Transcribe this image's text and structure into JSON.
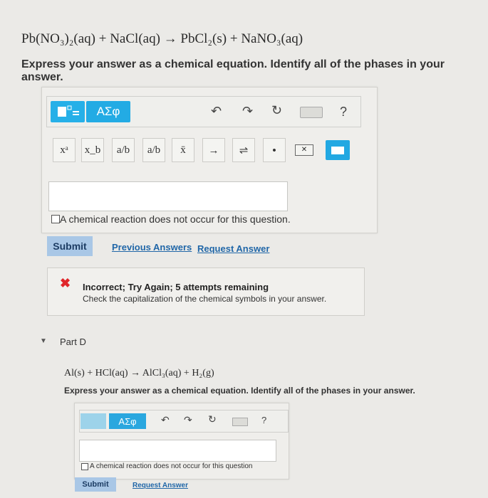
{
  "part_c": {
    "equation": "Pb(NO₃)₂(aq) + NaCl(aq) → PbCl₂(s) + NaNO₃(aq)",
    "instructions": "Express your answer as a chemical equation. Identify all of the phases in your answer.",
    "toolbar": {
      "greek_label": "ΑΣφ",
      "help_label": "?",
      "symbols": [
        "xᵃ",
        "x_b",
        "a/b",
        "a/b",
        "x̄",
        "→",
        "⇌",
        "•"
      ]
    },
    "no_reaction_label": "A chemical reaction does not occur for this question.",
    "submit_label": "Submit",
    "previous_answers_label": "Previous Answers",
    "request_answer_label": "Request Answer",
    "feedback": {
      "title": "Incorrect; Try Again; 5 attempts remaining",
      "message": "Check the capitalization of the chemical symbols in your answer."
    }
  },
  "part_d": {
    "label": "Part D",
    "equation": "Al(s) + HCl(aq) → AlCl₃(aq) + H₂(g)",
    "instructions": "Express your answer as a chemical equation. Identify all of the phases in your answer.",
    "toolbar": {
      "greek_label": "ΑΣφ",
      "help_label": "?"
    },
    "no_reaction_label": "A chemical reaction does not occur for this question",
    "submit_label": "Submit",
    "request_answer_label": "Request Answer"
  },
  "colors": {
    "accent_blue": "#26b0e8",
    "submit_bg": "#a9c7e6",
    "link": "#2167a8",
    "error": "#e0262a"
  }
}
